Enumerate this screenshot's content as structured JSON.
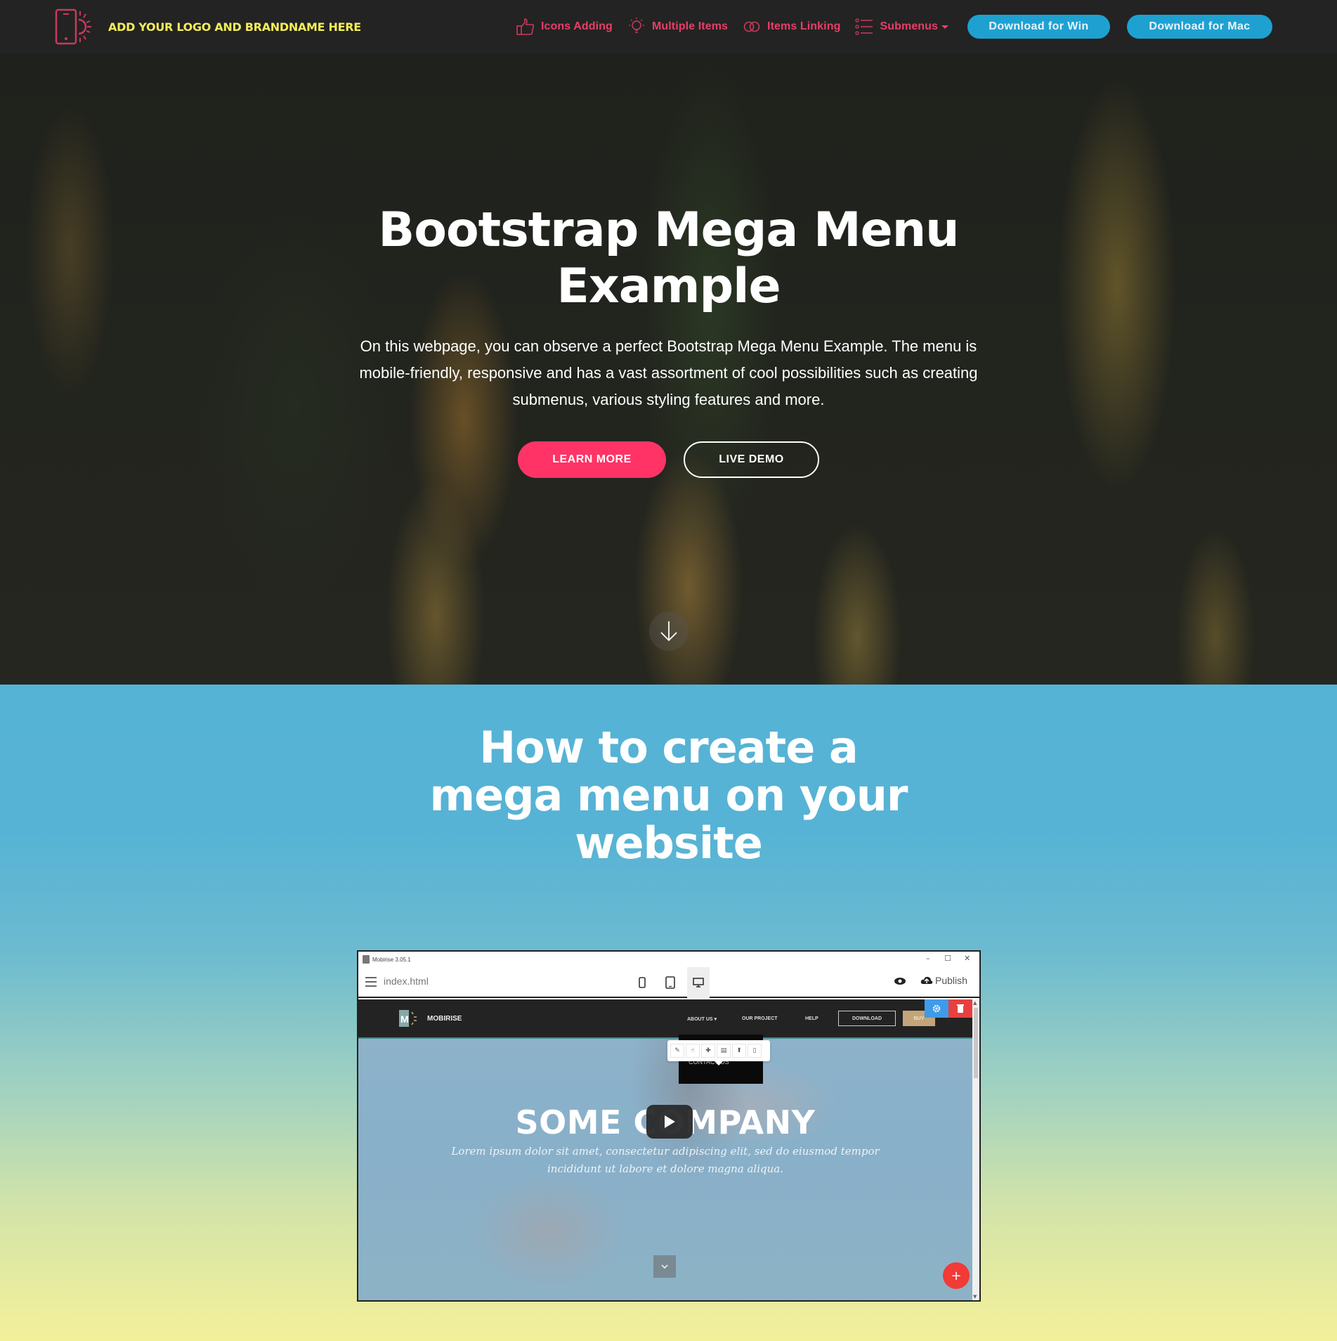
{
  "navbar": {
    "brand_text": "ADD YOUR LOGO AND BRANDNAME HERE",
    "brand_icon": "phone-sun-icon",
    "links": [
      {
        "label": "Icons Adding",
        "icon": "thumbs-up-icon"
      },
      {
        "label": "Multiple Items",
        "icon": "lightbulb-icon"
      },
      {
        "label": "Items Linking",
        "icon": "link-icon"
      },
      {
        "label": "Submenus",
        "icon": "list-icon",
        "has_dropdown": true
      }
    ],
    "download_win": "Download for Win",
    "download_mac": "Download for Mac",
    "colors": {
      "link": "#e83e68",
      "brand": "#f3ec5a",
      "button": "#1ea1d1",
      "background": "#232323"
    }
  },
  "hero": {
    "title_line1": "Bootstrap Mega Menu",
    "title_line2": "Example",
    "text": "On this webpage, you can observe a perfect Bootstrap Mega Menu Example. The menu is mobile-friendly, responsive and has a vast assortment of cool possibilities such as creating submenus, various styling features and more.",
    "learn_more": "LEARN MORE",
    "live_demo": "LIVE DEMO",
    "scroll_icon": "arrow-down-icon",
    "colors": {
      "primary_button": "#ff3366"
    }
  },
  "section2": {
    "title_line1": "How to create a",
    "title_line2": "mega menu on your",
    "title_line3": "website"
  },
  "app_screenshot": {
    "window_title": "Mobirise 3.05.1",
    "file_name": "index.html",
    "publish_label": "Publish",
    "devices": [
      "mobile",
      "tablet",
      "desktop"
    ],
    "active_device": "desktop",
    "site": {
      "brand": "MOBIRISE",
      "logo_letter": "M",
      "nav_links": [
        "ABOUT US ▾",
        "OUR PROJECT",
        "HELP"
      ],
      "download_label": "DOWNLOAD",
      "buy_label": "BUY",
      "dropdown_item": "CONTACT US",
      "headline": "SOME COMPANY",
      "body_text": "Lorem ipsum dolor sit amet, consectetur adipiscing elit, sed do eiusmod tempor incididunt ut labore et dolore magna aliqua.",
      "fab_label": "+"
    }
  }
}
